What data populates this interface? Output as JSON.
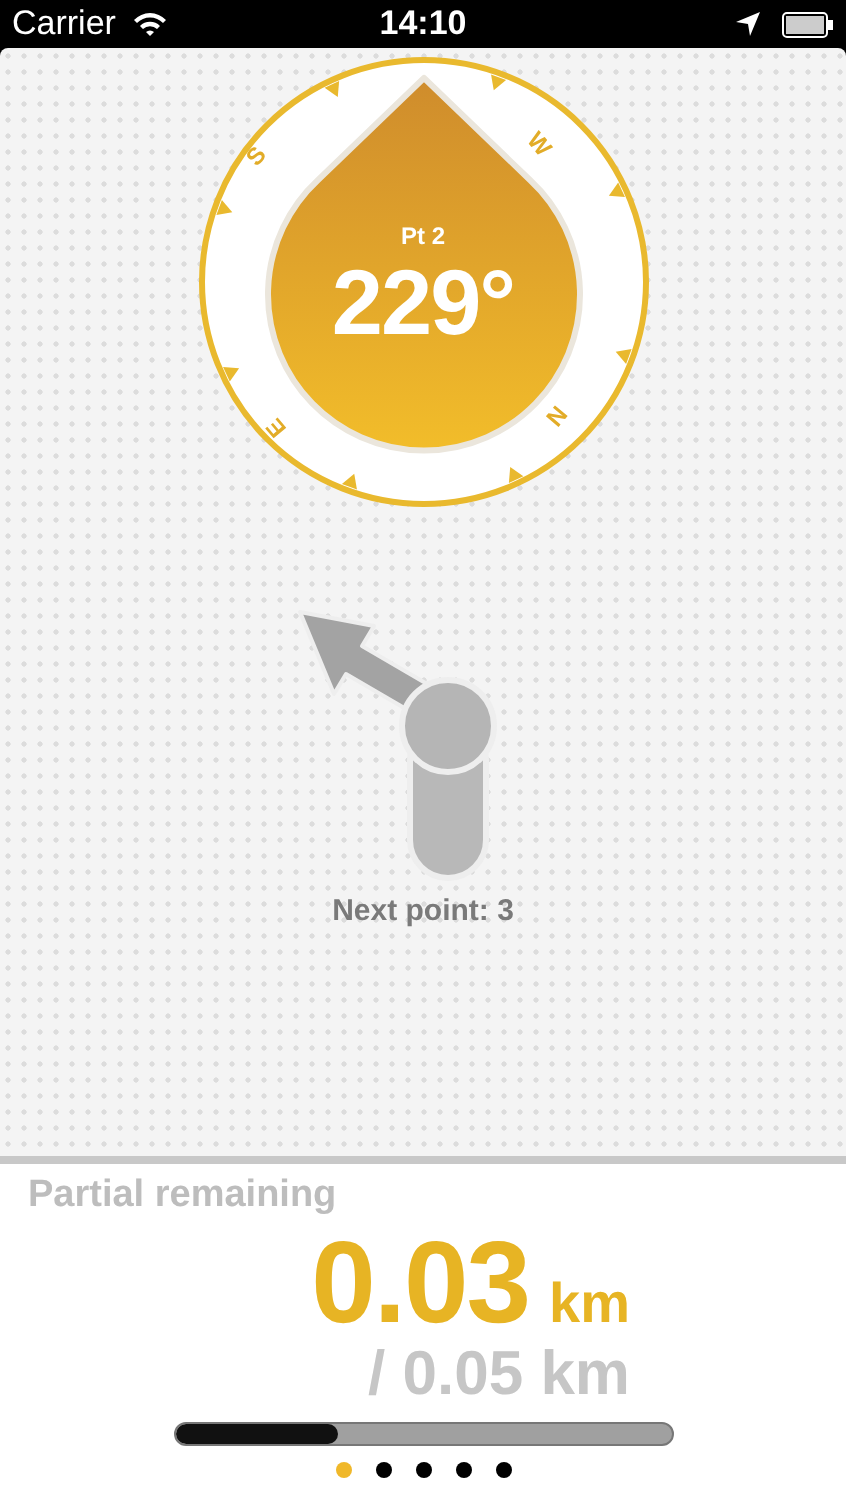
{
  "status_bar": {
    "carrier": "Carrier",
    "time": "14:10"
  },
  "compass": {
    "labels": [
      {
        "text": "S",
        "kind": "s"
      },
      {
        "text": "W",
        "kind": "w"
      },
      {
        "text": "N",
        "kind": "n"
      },
      {
        "text": "E",
        "kind": "e"
      }
    ],
    "point": "Pt 2",
    "bearing": "229°"
  },
  "next_point": "Next point: 3",
  "distance": {
    "label": "Partial remaining",
    "value": "0.03",
    "unit": "km",
    "total": "/ 0.05 km",
    "level": 0.33
  },
  "pages": [
    {
      "selected": true
    },
    {
      "selected": false
    },
    {
      "selected": false
    },
    {
      "selected": false
    },
    {
      "selected": false
    }
  ]
}
